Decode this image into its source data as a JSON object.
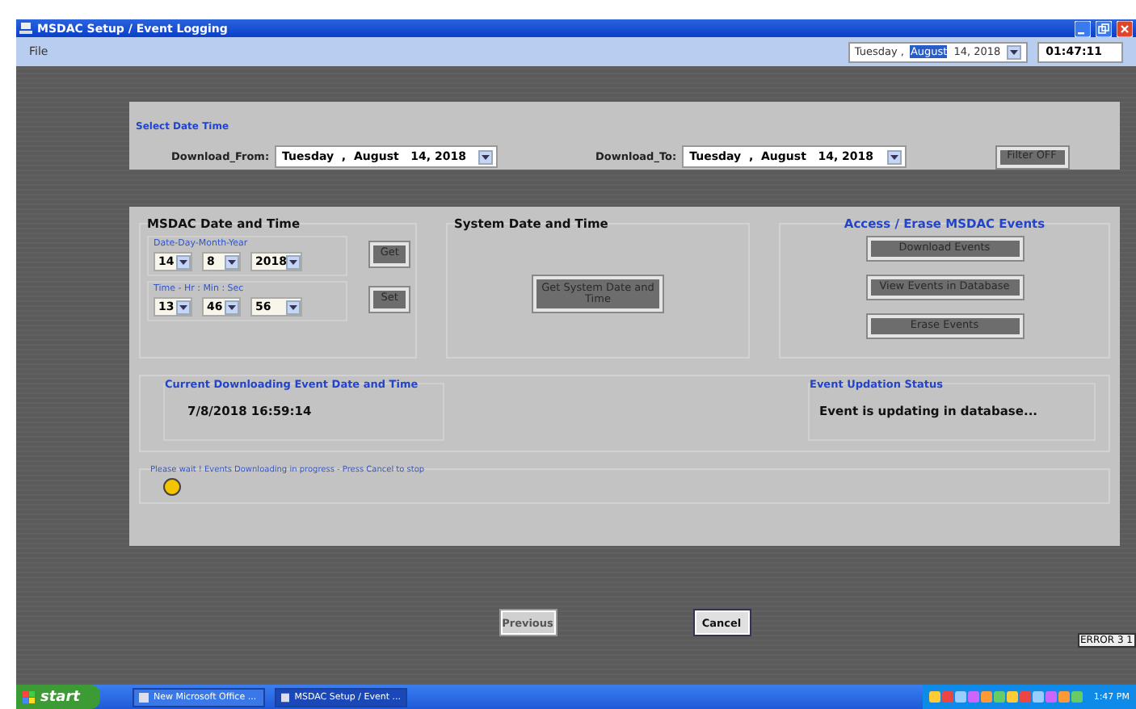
{
  "window": {
    "title": "MSDAC Setup / Event Logging"
  },
  "menu": [
    {
      "label": "File"
    }
  ],
  "header_date": {
    "weekday": "Tuesday ,",
    "month": "August",
    "rest": "14, 2018",
    "time": "01:47:11"
  },
  "filter": {
    "title": "Select Date  Time",
    "from_label": "Download_From:",
    "from": "Tuesday  ,  August   14, 2018",
    "to_label": "Download_To:",
    "to": "Tuesday  ,  August   14, 2018",
    "button": "Filter OFF"
  },
  "msdac_time": {
    "title": "MSDAC Date and Time",
    "date_label": "Date-Day-Month-Year",
    "date": [
      {
        "value": "14"
      },
      {
        "value": "8"
      },
      {
        "value": "2018"
      }
    ],
    "get_button": "Get",
    "time_label": "Time - Hr : Min : Sec",
    "time": [
      {
        "value": "13"
      },
      {
        "value": "46"
      },
      {
        "value": "56"
      }
    ],
    "set_button": "Set"
  },
  "system_time": {
    "title": "System Date and Time",
    "button": "Get System Date and Time"
  },
  "access": {
    "title": "Access / Erase  MSDAC Events",
    "buttons": [
      "Download Events",
      "View Events in Database",
      "Erase Events"
    ]
  },
  "current_event": {
    "title": "Current Downloading Event Date and Time",
    "value": "7/8/2018 16:59:14"
  },
  "update_status": {
    "title": "Event Updation Status",
    "value": "Event is updating in database..."
  },
  "progress": {
    "message": "Please wait ! Events Downloading in progress - Press Cancel to stop",
    "color": "#f5c400"
  },
  "nav_buttons": [
    {
      "label": "Previous",
      "disabled": true
    },
    {
      "label": "Cancel",
      "disabled": false
    }
  ],
  "error_label": "ERROR 3 1",
  "taskbar": {
    "start": "start",
    "tasks": [
      {
        "label": "New Microsoft Office ...",
        "selected": false
      },
      {
        "label": "MSDAC Setup / Event ...",
        "selected": true
      }
    ],
    "clock": "1:47 PM"
  }
}
